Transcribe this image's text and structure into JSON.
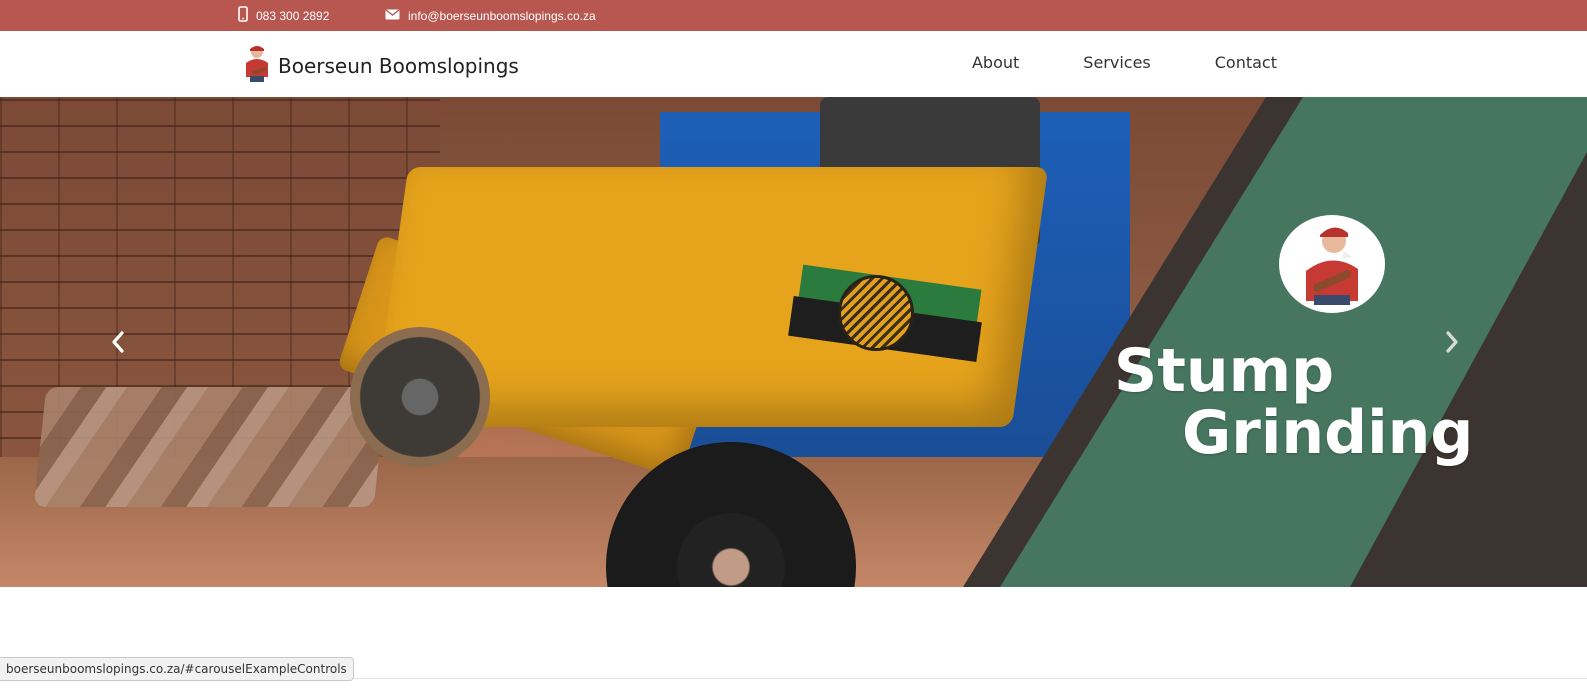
{
  "colors": {
    "top_bar": "#b85750",
    "green_panel": "#467660",
    "dark_panel": "#3b3430"
  },
  "topbar": {
    "phone_icon": "mobile-phone-icon",
    "phone": "083 300 2892",
    "email_icon": "envelope-icon",
    "email": "info@boerseunboomslopings.co.za"
  },
  "navbar": {
    "brand": "Boerseun Boomslopings",
    "logo_icon": "lumberjack-mascot-icon",
    "links": [
      {
        "label": "About"
      },
      {
        "label": "Services"
      },
      {
        "label": "Contact"
      }
    ]
  },
  "hero": {
    "title_line1": "Stump",
    "title_line2": "Grinding",
    "prev_icon": "chevron-left-icon",
    "next_icon": "chevron-right-icon"
  },
  "status_bar": {
    "url": "boerseunboomslopings.co.za/#carouselExampleControls"
  }
}
